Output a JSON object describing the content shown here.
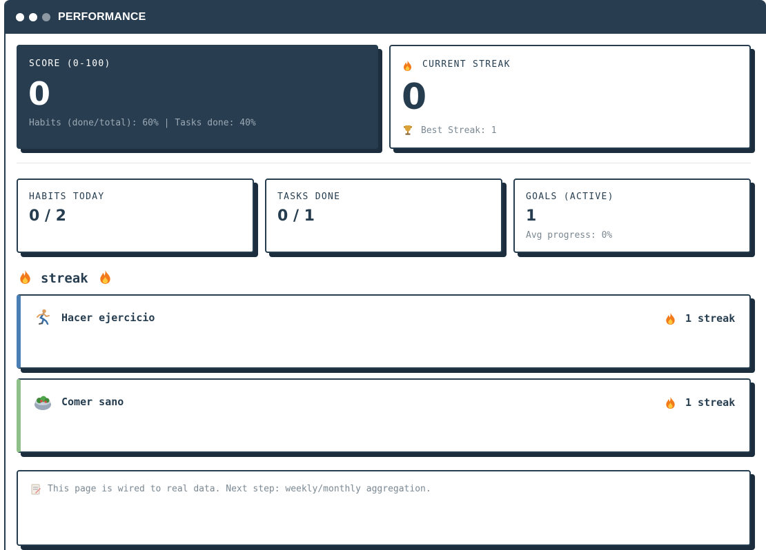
{
  "window": {
    "title": "PERFORMANCE"
  },
  "score": {
    "label": "SCORE (0-100)",
    "value": "0",
    "detail": "Habits (done/total): 60% | Tasks done: 40%"
  },
  "current_streak": {
    "icon": "fire-icon",
    "label": "CURRENT STREAK",
    "value": "0",
    "best_icon": "trophy-icon",
    "best_text": "Best Streak: 1"
  },
  "stats": [
    {
      "label": "HABITS TODAY",
      "value": "0 / 2"
    },
    {
      "label": "TASKS DONE",
      "value": "0 / 1"
    },
    {
      "label": "GOALS (ACTIVE)",
      "value": "1",
      "detail": "Avg progress: 0%"
    }
  ],
  "streak_section": {
    "title": "streak"
  },
  "habits": [
    {
      "icon": "runner-icon",
      "name": "Hacer ejercicio",
      "streak": "1 streak",
      "accent": "#4a7fb5"
    },
    {
      "icon": "salad-icon",
      "name": "Comer sano",
      "streak": "1 streak",
      "accent": "#8fc08a"
    }
  ],
  "note": {
    "icon": "memo-icon",
    "text": "This page is wired to real data. Next step: weekly/monthly aggregation."
  },
  "colors": {
    "navy": "#283e50",
    "blue_accent": "#4a7fb5",
    "green_accent": "#8fc08a"
  }
}
